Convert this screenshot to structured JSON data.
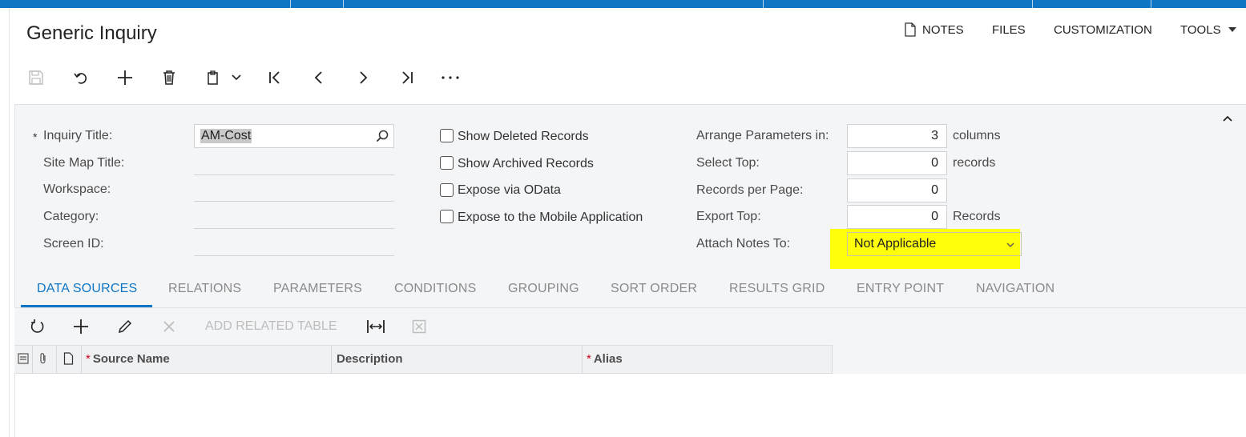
{
  "window": {
    "title": "Generic Inquiry"
  },
  "header_actions": {
    "notes": "NOTES",
    "files": "FILES",
    "customization": "CUSTOMIZATION",
    "tools": "TOOLS"
  },
  "toolbar": {
    "icons": [
      "save-icon",
      "undo-icon",
      "add-icon",
      "delete-icon",
      "clipboard-icon",
      "chevron-down-icon",
      "first-record-icon",
      "previous-icon",
      "next-icon",
      "last-record-icon",
      "more-icon"
    ]
  },
  "form": {
    "inquiry_title": {
      "label": "Inquiry Title:",
      "value": "AM-Cost",
      "required_mark": "*"
    },
    "site_map_title": {
      "label": "Site Map Title:",
      "value": ""
    },
    "workspace": {
      "label": "Workspace:",
      "value": ""
    },
    "category": {
      "label": "Category:",
      "value": ""
    },
    "screen_id": {
      "label": "Screen ID:",
      "value": ""
    },
    "show_deleted": {
      "label": "Show Deleted Records",
      "checked": false
    },
    "show_archived": {
      "label": "Show Archived Records",
      "checked": false
    },
    "expose_odata": {
      "label": "Expose via OData",
      "checked": false
    },
    "expose_mobile": {
      "label": "Expose to the Mobile Application",
      "checked": false
    },
    "arrange_params": {
      "label": "Arrange Parameters in:",
      "value": "3",
      "unit": "columns"
    },
    "select_top": {
      "label": "Select Top:",
      "value": "0",
      "unit": "records"
    },
    "records_per_page": {
      "label": "Records per Page:",
      "value": "0"
    },
    "export_top": {
      "label": "Export Top:",
      "value": "0",
      "unit": "Records"
    },
    "attach_notes": {
      "label": "Attach Notes To:",
      "value": "Not Applicable",
      "highlight_color": "#ffff0b"
    }
  },
  "tabs": [
    {
      "label": "DATA SOURCES",
      "active": true
    },
    {
      "label": "RELATIONS"
    },
    {
      "label": "PARAMETERS"
    },
    {
      "label": "CONDITIONS"
    },
    {
      "label": "GROUPING"
    },
    {
      "label": "SORT ORDER"
    },
    {
      "label": "RESULTS GRID"
    },
    {
      "label": "ENTRY POINT"
    },
    {
      "label": "NAVIGATION"
    }
  ],
  "grid": {
    "toolbar": {
      "add_related_table": "ADD RELATED TABLE"
    },
    "columns": [
      {
        "label": "Source Name",
        "required_mark": "*"
      },
      {
        "label": "Description"
      },
      {
        "label": "Alias",
        "required_mark": "*"
      }
    ]
  },
  "colors": {
    "accent": "#0e76c5",
    "panel_bg": "#f4f5f7",
    "required": "#d0021b"
  }
}
